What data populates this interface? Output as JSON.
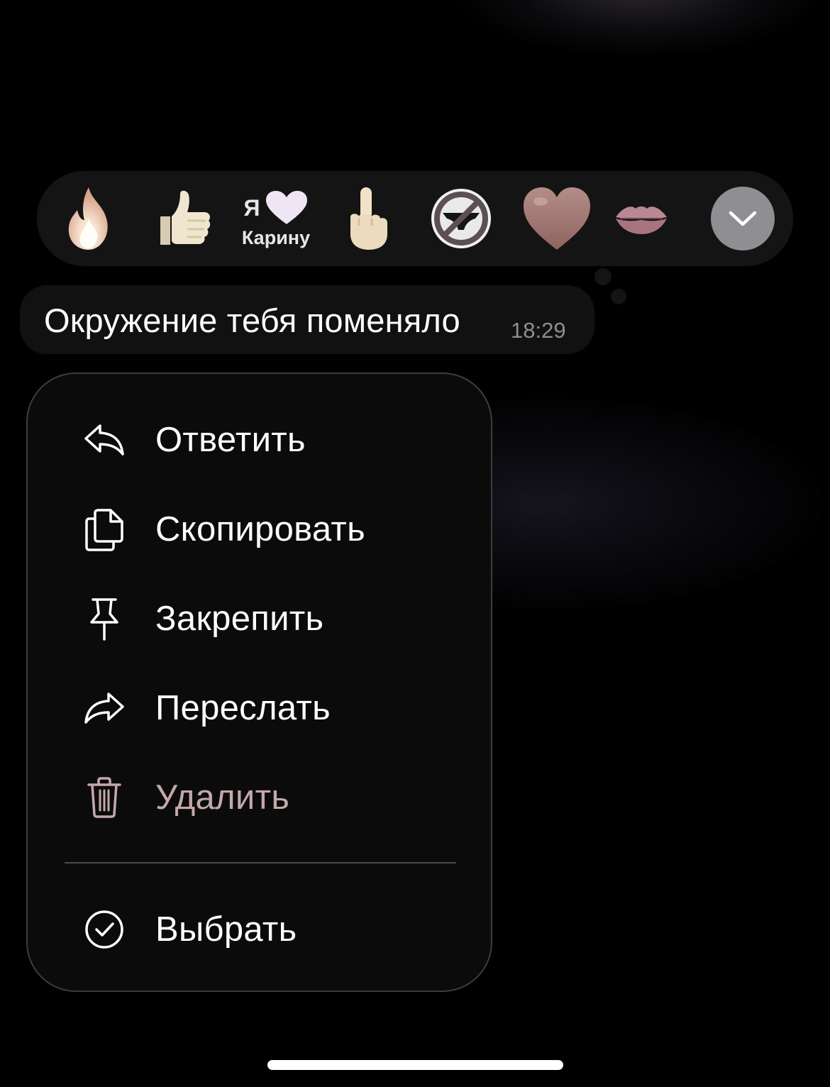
{
  "reactions": [
    {
      "name": "fire",
      "icon": "fire-icon"
    },
    {
      "name": "thumbs-up",
      "icon": "thumbs-up-icon"
    },
    {
      "name": "ya-love-karinu",
      "icon": "heart-icon",
      "line1": "Я",
      "line2": "Карину"
    },
    {
      "name": "middle-finger",
      "icon": "middle-finger-icon"
    },
    {
      "name": "no-underwear",
      "icon": "prohibited-underwear-icon"
    },
    {
      "name": "heart",
      "icon": "heart-icon"
    },
    {
      "name": "kiss",
      "icon": "lips-icon"
    }
  ],
  "reaction_expand_icon": "chevron-down-icon",
  "message": {
    "text": "Окружение тебя поменяло",
    "time": "18:29"
  },
  "menu": {
    "items": [
      {
        "label": "Ответить",
        "icon": "reply-icon"
      },
      {
        "label": "Скопировать",
        "icon": "copy-icon"
      },
      {
        "label": "Закрепить",
        "icon": "pin-icon"
      },
      {
        "label": "Переслать",
        "icon": "forward-icon"
      },
      {
        "label": "Удалить",
        "icon": "trash-icon",
        "destructive": true
      }
    ],
    "select": {
      "label": "Выбрать",
      "icon": "check-circle-icon"
    }
  },
  "colors": {
    "background": "#000000",
    "panel": "#141414",
    "destructive": "#c4a8ab",
    "heart": "#a47b78",
    "expand_button": "#8e8e93"
  }
}
